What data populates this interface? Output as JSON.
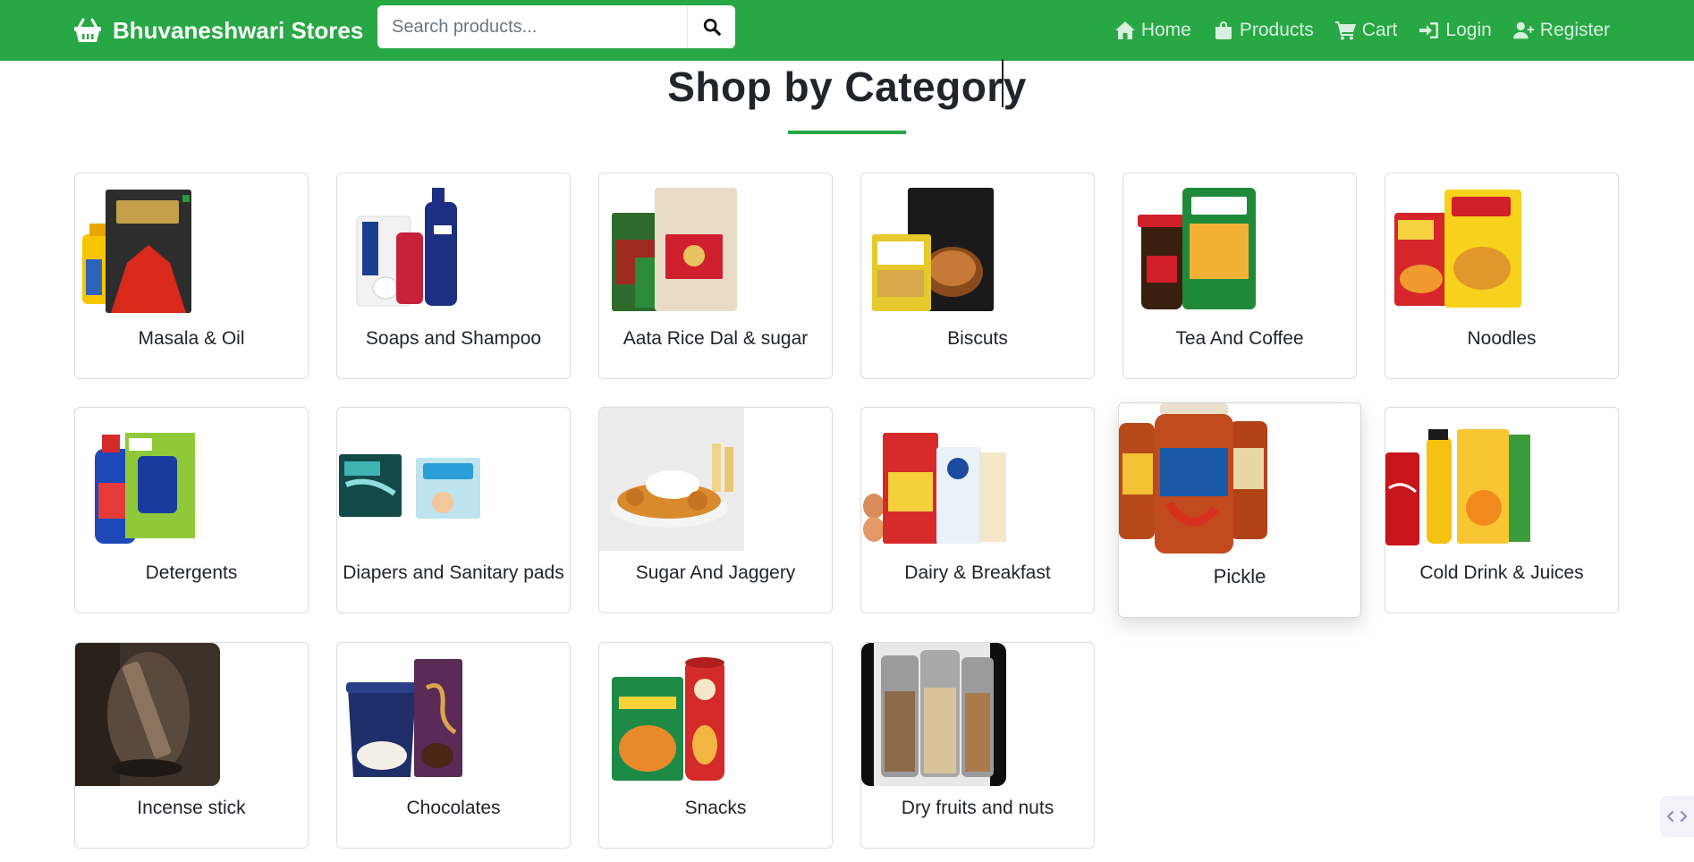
{
  "navbar": {
    "brand": "Bhuvaneshwari Stores",
    "search_placeholder": "Search products...",
    "links": [
      {
        "label": "Home",
        "icon": "home-icon"
      },
      {
        "label": "Products",
        "icon": "shopping-bag-icon"
      },
      {
        "label": "Cart",
        "icon": "cart-icon"
      },
      {
        "label": "Login",
        "icon": "login-icon"
      },
      {
        "label": "Register",
        "icon": "user-plus-icon"
      }
    ]
  },
  "page": {
    "title": "Shop by Category"
  },
  "colors": {
    "brand_green": "#28a745",
    "card_border": "#dcdcdc",
    "text": "#212529"
  },
  "categories": [
    {
      "label": "Masala & Oil"
    },
    {
      "label": "Soaps and Shampoo"
    },
    {
      "label": "Aata Rice Dal & sugar"
    },
    {
      "label": "Biscuts"
    },
    {
      "label": "Tea And Coffee"
    },
    {
      "label": "Noodles"
    },
    {
      "label": "Detergents"
    },
    {
      "label": "Diapers and Sanitary pads"
    },
    {
      "label": "Sugar And Jaggery"
    },
    {
      "label": "Dairy & Breakfast"
    },
    {
      "label": "Pickle"
    },
    {
      "label": "Cold Drink & Juices"
    },
    {
      "label": "Incense stick"
    },
    {
      "label": "Chocolates"
    },
    {
      "label": "Snacks"
    },
    {
      "label": "Dry fruits and nuts"
    }
  ]
}
